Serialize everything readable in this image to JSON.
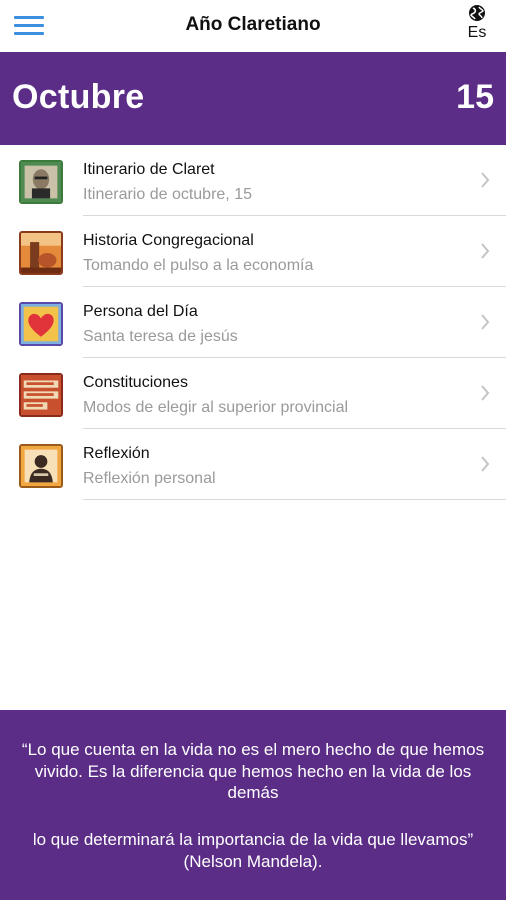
{
  "navbar": {
    "title": "Año Claretiano",
    "language": "Es",
    "menu_icon": "hamburger-menu-icon",
    "language_icon": "globe-icon",
    "accent_color": "#3d8fe0"
  },
  "header": {
    "month": "Octubre",
    "day": "15",
    "background_color": "#5b2d87"
  },
  "items": [
    {
      "title": "Itinerario de Claret",
      "subtitle": "Itinerario de octubre, 15",
      "icon": "claret-portrait-icon"
    },
    {
      "title": "Historia Congregacional",
      "subtitle": "Tomando el pulso a la economía",
      "icon": "history-figure-icon"
    },
    {
      "title": "Persona del Día",
      "subtitle": "Santa teresa de jesús",
      "icon": "heart-icon"
    },
    {
      "title": "Constituciones",
      "subtitle": "Modos de elegir al superior provincial",
      "icon": "constitutions-book-icon"
    },
    {
      "title": "Reflexión",
      "subtitle": "Reflexión personal",
      "icon": "reflection-person-icon"
    }
  ],
  "footer": {
    "quote_line1": "“Lo que cuenta en la vida no es el mero hecho de que hemos vivido. Es la diferencia que hemos hecho en la vida de los demás",
    "quote_line2": "lo que determinará la importancia de la vida que llevamos” (Nelson Mandela).",
    "background_color": "#5b2d87"
  }
}
